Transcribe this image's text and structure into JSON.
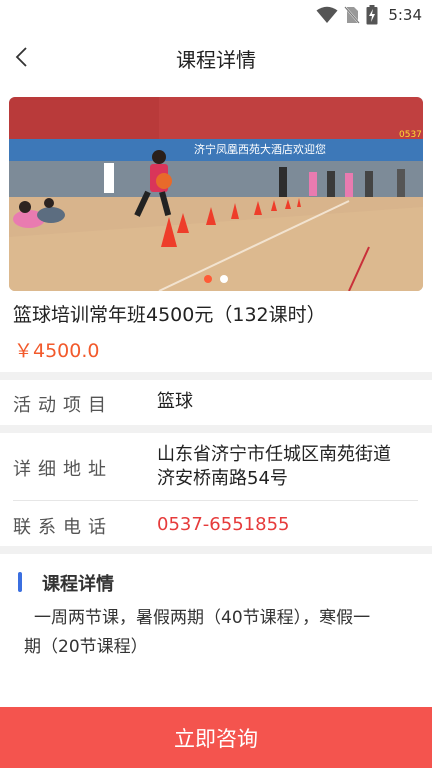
{
  "status_bar": {
    "time": "5:34",
    "icons": [
      "wifi-icon",
      "no-sim-icon",
      "battery-charging-icon"
    ]
  },
  "nav": {
    "title": "课程详情",
    "back_icon": "chevron-left-icon"
  },
  "banner": {
    "sign_text": "济宁凤凰西苑大酒店欢迎您",
    "sign_number": "0537",
    "slide_count": 2,
    "active_slide": 1
  },
  "course": {
    "title": "篮球培训常年班4500元（132课时）",
    "price": "￥4500.0"
  },
  "info": {
    "activity_label": "活动项目",
    "activity_value": "篮球",
    "address_label": "详细地址",
    "address_line1": "山东省济宁市任城区南苑街道",
    "address_line2": "济安桥南路54号",
    "phone_label": "联系电话",
    "phone_value": "0537-6551855"
  },
  "details": {
    "title": "课程详情",
    "line1": "一周两节课，暑假两期（40节课程），寒假一",
    "line2": "期（20节课程）"
  },
  "cta": {
    "label": "立即咨询"
  },
  "colors": {
    "accent_red": "#f4544e",
    "price_orange": "#f25a2c",
    "phone_red": "#e63b3b",
    "section_blue": "#3b6fe0"
  }
}
